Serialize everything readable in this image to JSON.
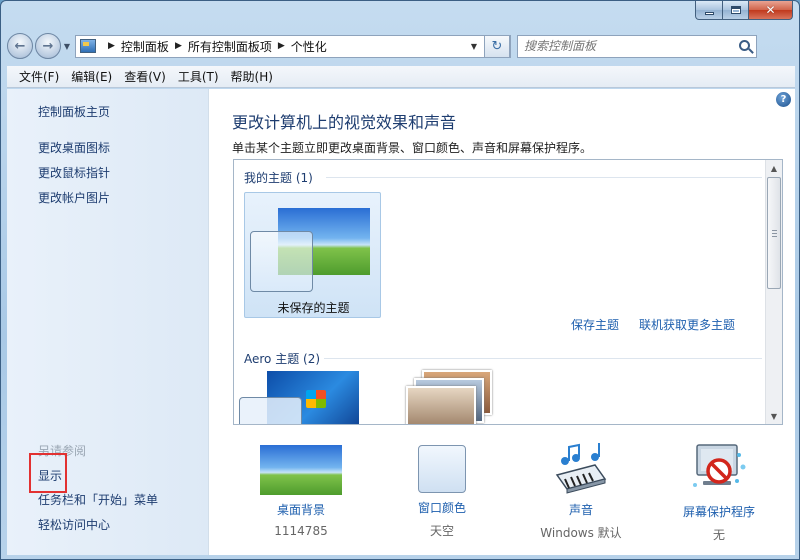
{
  "window": {
    "close_glyph": "✕"
  },
  "address_bar": {
    "crumbs": [
      "控制面板",
      "所有控制面板项",
      "个性化"
    ],
    "refresh_glyph": "↻"
  },
  "search": {
    "placeholder": "搜索控制面板"
  },
  "menubar": {
    "items": [
      "文件(F)",
      "编辑(E)",
      "查看(V)",
      "工具(T)",
      "帮助(H)"
    ]
  },
  "sidebar": {
    "links": [
      "控制面板主页",
      "更改桌面图标",
      "更改鼠标指针",
      "更改帐户图片"
    ],
    "see_also_heading": "另请参阅",
    "see_also_links": [
      "显示",
      "任务栏和「开始」菜单",
      "轻松访问中心"
    ]
  },
  "main": {
    "help_glyph": "?",
    "title": "更改计算机上的视觉效果和声音",
    "subtitle": "单击某个主题立即更改桌面背景、窗口颜色、声音和屏幕保护程序。",
    "my_themes_label": "我的主题 (1)",
    "selected_theme_name": "未保存的主题",
    "save_theme_link": "保存主题",
    "get_more_themes_link": "联机获取更多主题",
    "aero_themes_label": "Aero 主题 (2)"
  },
  "bottom": {
    "desktop_background": {
      "label": "桌面背景",
      "value": "1114785"
    },
    "window_color": {
      "label": "窗口颜色",
      "value": "天空"
    },
    "sounds": {
      "label": "声音",
      "value": "Windows 默认"
    },
    "screen_saver": {
      "label": "屏幕保护程序",
      "value": "无"
    }
  },
  "colors": {
    "link": "#1e5fae",
    "highlight_box": "#e23131"
  }
}
